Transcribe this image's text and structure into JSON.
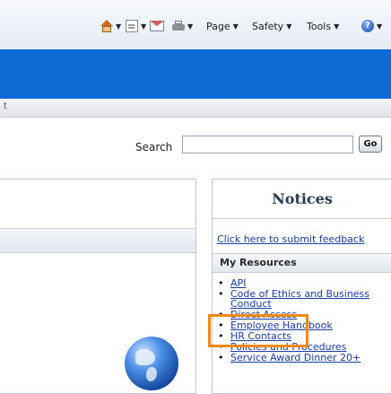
{
  "toolbar": {
    "page_label": "Page",
    "safety_label": "Safety",
    "tools_label": "Tools"
  },
  "breadcrumb": {
    "text": "t"
  },
  "search": {
    "label": "Search",
    "value": "",
    "go_label": "Go"
  },
  "notices": {
    "title": "Notices",
    "feedback_link": "Click here to submit feedback",
    "resources_header": "My Resources",
    "resources": [
      "API",
      "Code of Ethics and Business Conduct",
      "Direct Access",
      "Employee Handbook",
      "HR Contacts",
      "Policies and Procedures",
      "Service Award Dinner 20+"
    ]
  },
  "colors": {
    "banner": "#0f6ad6",
    "link": "#1a3ea8",
    "highlight": "#f08a16"
  },
  "icons": [
    "home-icon",
    "feed-icon",
    "mail-icon",
    "print-icon",
    "help-icon",
    "globe-icon"
  ]
}
